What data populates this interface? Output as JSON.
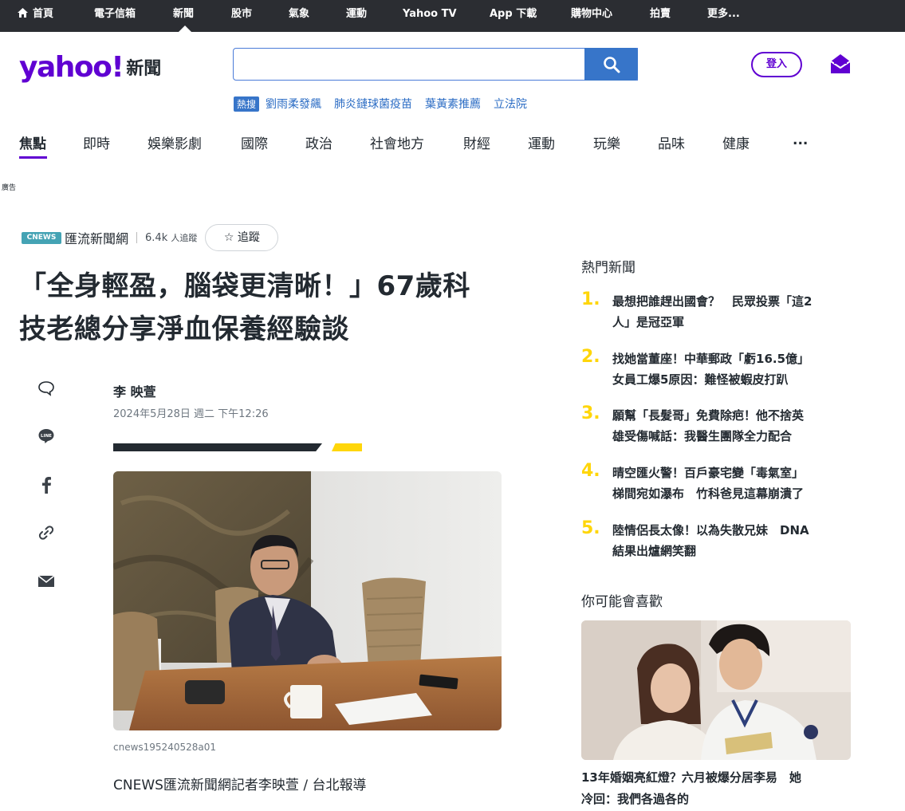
{
  "topnav": {
    "items": [
      "首頁",
      "電子信箱",
      "新聞",
      "股市",
      "氣象",
      "運動",
      "Yahoo TV",
      "App 下載",
      "購物中心",
      "拍賣",
      "更多..."
    ]
  },
  "header": {
    "logo_text": "yahoo!",
    "section_label": "新聞",
    "search_placeholder": "",
    "login_label": "登入"
  },
  "trending": {
    "badge": "熱搜",
    "links": [
      "劉雨柔發飆",
      "肺炎鏈球菌疫苗",
      "葉黃素推薦",
      "立法院"
    ]
  },
  "categories": [
    "焦點",
    "即時",
    "娛樂影劇",
    "國際",
    "政治",
    "社會地方",
    "財經",
    "運動",
    "玩樂",
    "品味",
    "健康",
    "..."
  ],
  "ad_label": "廣告",
  "article": {
    "publisher_logo": "CNEWS",
    "publisher_name": "匯流新聞網",
    "followers": "6.4k",
    "followers_suffix": "人追蹤",
    "follow_label": "追蹤",
    "headline_line1": "「全身輕盈，腦袋更清晰！」67歲科",
    "headline_line2": "技老總分享淨血保養經驗談",
    "author": "李 映萱",
    "date": "2024年5月28日 週二 下午12:26",
    "image_caption": "cnews195240528a01",
    "first_paragraph": "CNEWS匯流新聞網記者李映萱 / 台北報導"
  },
  "share_icons": [
    "comment-icon",
    "line-icon",
    "facebook-icon",
    "link-icon",
    "mail-icon"
  ],
  "rail": {
    "hot_title": "熱門新聞",
    "hot_news": [
      {
        "rank": "1.",
        "line1": "最想把誰趕出國會？　民眾投票「這2",
        "line2": "人」是冠亞軍"
      },
      {
        "rank": "2.",
        "line1": "找她當董座！中華郵政「虧16.5億」",
        "line2": "女員工爆5原因：難怪被蝦皮打趴"
      },
      {
        "rank": "3.",
        "line1": "願幫「長髮哥」免費除疤！他不捨英",
        "line2": "雄受傷喊話：我醫生團隊全力配合"
      },
      {
        "rank": "4.",
        "line1": "晴空匯火警！百戶豪宅變「毒氣室」",
        "line2": "梯間宛如瀑布　竹科爸見這幕崩潰了"
      },
      {
        "rank": "5.",
        "line1": "陸情侶長太像！以為失散兄妹　DNA",
        "line2": "結果出爐網笑翻"
      }
    ],
    "recommend_title": "你可能會喜歡",
    "recommend_line1": "13年婚姻亮紅燈？六月被爆分居李易　她",
    "recommend_line2": "冷回：我們各過各的"
  },
  "colors": {
    "brand_purple": "#6001d2",
    "topbar": "#2b2d32",
    "search_blue": "#3775c9",
    "rank_yellow": "#ffd60a"
  }
}
